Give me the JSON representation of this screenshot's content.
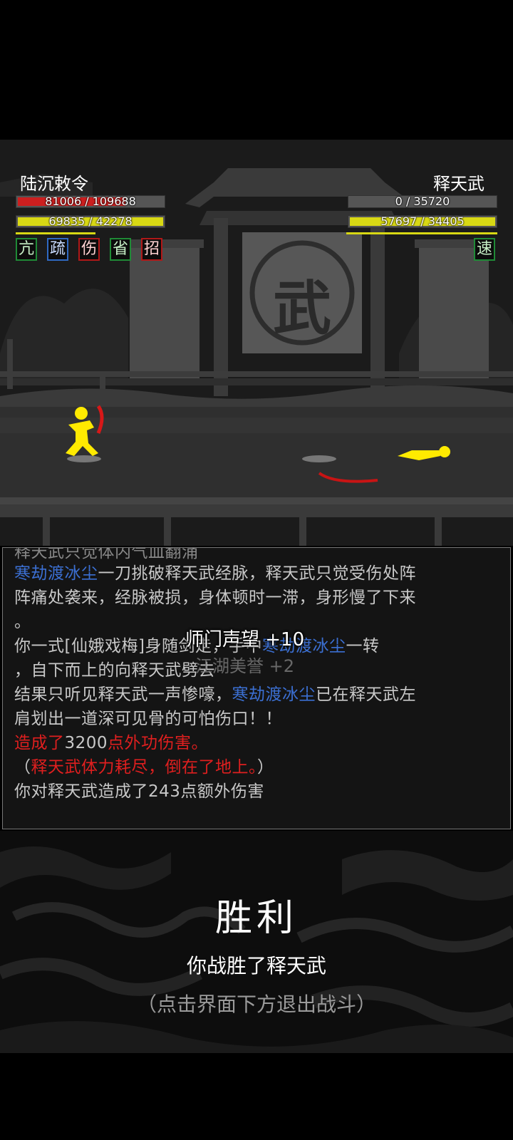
{
  "player": {
    "name": "陆沉敕令",
    "hp_text": "81006 / 109688",
    "hp_fraction": 0.74,
    "mp_text": "69835 / 42278",
    "mp_fraction": 1.0,
    "status_badges": [
      {
        "glyph": "亢",
        "color": "green"
      },
      {
        "glyph": "疏",
        "color": "blue"
      },
      {
        "glyph": "伤",
        "color": "red"
      },
      {
        "glyph": "省",
        "color": "green"
      },
      {
        "glyph": "招",
        "color": "red"
      }
    ]
  },
  "enemy": {
    "name": "释天武",
    "hp_text": "0 / 35720",
    "hp_fraction": 0.0,
    "mp_text": "57697 / 34405",
    "mp_fraction": 1.0,
    "status_badges": [
      {
        "glyph": "速",
        "color": "green"
      }
    ]
  },
  "scene": {
    "gate_emblem": "武"
  },
  "floating_text": {
    "reputation": "师门声望 +10",
    "honor": "江湖美誉 +2"
  },
  "combat_log": {
    "line0": "释天武只觉体内气血翻涌",
    "line1": {
      "a": "寒劫渡冰尘",
      "b": "一刀挑破释天武经脉，释天武只觉受伤处阵"
    },
    "line2": "阵痛处袭来，经脉被损，身体顿时一滞，身形慢了下来",
    "line3": "。",
    "line4": {
      "a": "你一式[仙娥戏梅]身随剑走，",
      "b": "手中",
      "c": "寒劫渡冰尘",
      "d": "一转"
    },
    "line5": "，自下而上的向释天武劈去",
    "line6": {
      "a": "结果只听见释天武一声惨嚎，",
      "b": "寒劫渡冰尘",
      "c": "已在释天武左"
    },
    "line7": "肩划出一道深可见骨的可怕伤口！！",
    "line8": {
      "a": "造成了",
      "b": "3200",
      "c": "点外功伤害。"
    },
    "line9": {
      "a": "（",
      "b": "释天武体力耗尽，倒在了地上。",
      "c": "）"
    },
    "line10": "你对释天武造成了243点额外伤害"
  },
  "result": {
    "title": "胜利",
    "subtitle": "你战胜了释天武",
    "hint": "（点击界面下方退出战斗）"
  },
  "colors": {
    "hp_bar": "#cc1f1f",
    "mp_bar": "#d8d814",
    "highlight_blue": "#3b6fd2",
    "highlight_red": "#e01f1f",
    "character": "#ffea00"
  }
}
